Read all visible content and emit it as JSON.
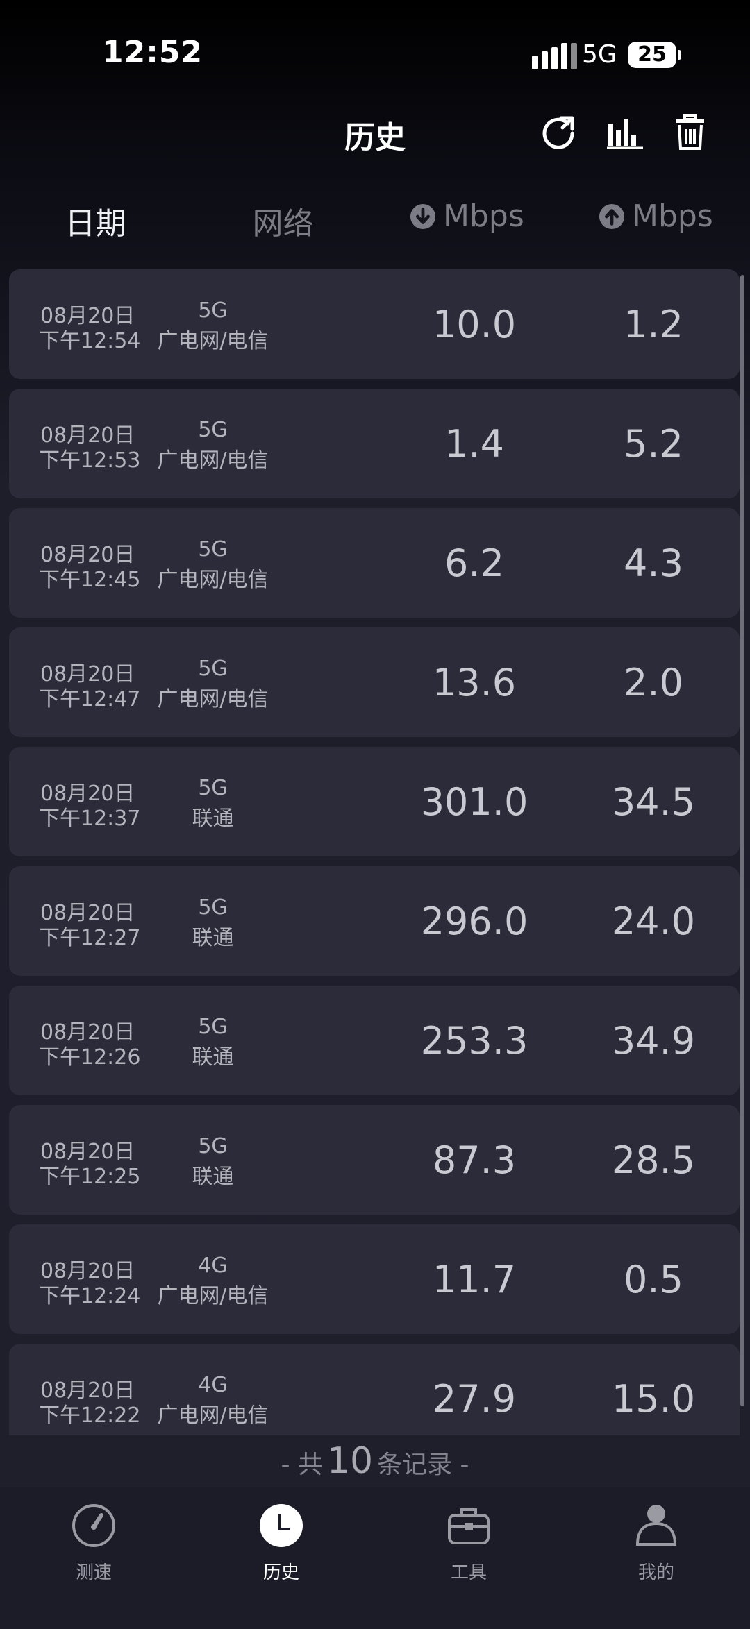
{
  "status_bar": {
    "time": "12:52",
    "network": "5G",
    "battery": "25"
  },
  "header": {
    "title": "历史",
    "icons": [
      "refresh-icon",
      "bar-chart-icon",
      "trash-icon"
    ]
  },
  "columns": {
    "date": "日期",
    "network": "网络",
    "download_unit": "Mbps",
    "upload_unit": "Mbps"
  },
  "rows": [
    {
      "date": "08月20日",
      "time": "下午12:54",
      "net_type": "5G",
      "carrier": "广电网/电信",
      "download": "10.0",
      "upload": "1.2"
    },
    {
      "date": "08月20日",
      "time": "下午12:53",
      "net_type": "5G",
      "carrier": "广电网/电信",
      "download": "1.4",
      "upload": "5.2"
    },
    {
      "date": "08月20日",
      "time": "下午12:45",
      "net_type": "5G",
      "carrier": "广电网/电信",
      "download": "6.2",
      "upload": "4.3"
    },
    {
      "date": "08月20日",
      "time": "下午12:47",
      "net_type": "5G",
      "carrier": "广电网/电信",
      "download": "13.6",
      "upload": "2.0"
    },
    {
      "date": "08月20日",
      "time": "下午12:37",
      "net_type": "5G",
      "carrier": "联通",
      "download": "301.0",
      "upload": "34.5"
    },
    {
      "date": "08月20日",
      "time": "下午12:27",
      "net_type": "5G",
      "carrier": "联通",
      "download": "296.0",
      "upload": "24.0"
    },
    {
      "date": "08月20日",
      "time": "下午12:26",
      "net_type": "5G",
      "carrier": "联通",
      "download": "253.3",
      "upload": "34.9"
    },
    {
      "date": "08月20日",
      "time": "下午12:25",
      "net_type": "5G",
      "carrier": "联通",
      "download": "87.3",
      "upload": "28.5"
    },
    {
      "date": "08月20日",
      "time": "下午12:24",
      "net_type": "4G",
      "carrier": "广电网/电信",
      "download": "11.7",
      "upload": "0.5"
    },
    {
      "date": "08月20日",
      "time": "下午12:22",
      "net_type": "4G",
      "carrier": "广电网/电信",
      "download": "27.9",
      "upload": "15.0"
    }
  ],
  "total": {
    "prefix": "- 共",
    "count": "10",
    "suffix": "条记录 -"
  },
  "tabs": [
    {
      "label": "测速",
      "icon": "speedometer-icon",
      "active": false
    },
    {
      "label": "历史",
      "icon": "clock-icon",
      "active": true
    },
    {
      "label": "工具",
      "icon": "toolbox-icon",
      "active": false
    },
    {
      "label": "我的",
      "icon": "user-icon",
      "active": false
    }
  ]
}
